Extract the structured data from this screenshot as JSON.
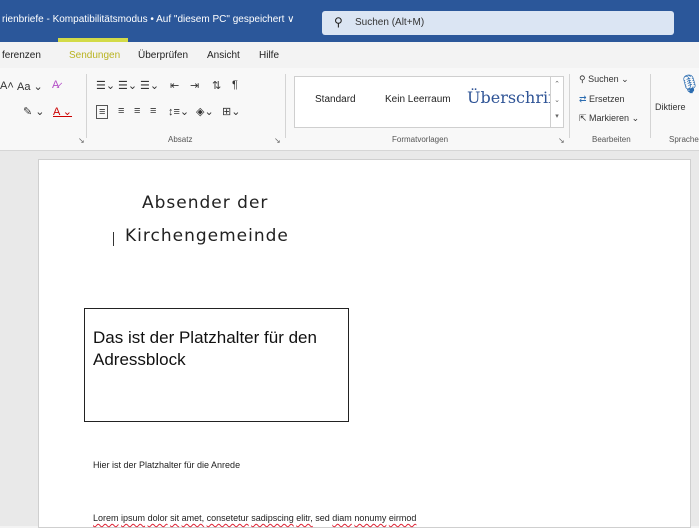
{
  "window": {
    "title": "rienbriefe - Kompatibilitätsmodus • Auf \"diesem PC\" gespeichert ∨",
    "search_placeholder": "Suchen (Alt+M)"
  },
  "tabs": [
    {
      "label": "ferenzen"
    },
    {
      "label": "Sendungen"
    },
    {
      "label": "Überprüfen"
    },
    {
      "label": "Ansicht"
    },
    {
      "label": "Hilfe"
    }
  ],
  "ribbon": {
    "font_group": {
      "fontsize_label": "Aa ⌄",
      "grow_label": "A˄"
    },
    "paragraph_group": {
      "label": "Absatz"
    },
    "styles_group": {
      "label": "Formatvorlagen",
      "items": [
        "Standard",
        "Kein Leerraum",
        "Überschrif"
      ]
    },
    "edit_group": {
      "label": "Bearbeiten",
      "find": "Suchen",
      "replace": "Ersetzen",
      "select": "Markieren"
    },
    "voice_group": {
      "label": "Sprache",
      "dictate": "Diktiere"
    }
  },
  "document": {
    "sender_line1": "Absender der",
    "sender_line2": "Kirchengemeinde",
    "address_placeholder": "Das ist der Platzhalter für den Adressblock",
    "salutation": "Hier ist der Platzhalter für die Anrede",
    "lorem": [
      "Lorem",
      "ipsum",
      "dolor",
      "sit",
      "amet,",
      "consetetur",
      "sadipscing",
      "elitr,",
      "sed",
      "diam",
      "nonumy",
      "eirmod"
    ]
  },
  "colors": {
    "titlebar": "#2b579a",
    "highlight": "#f1f23a",
    "heading_style": "#2f5496"
  }
}
